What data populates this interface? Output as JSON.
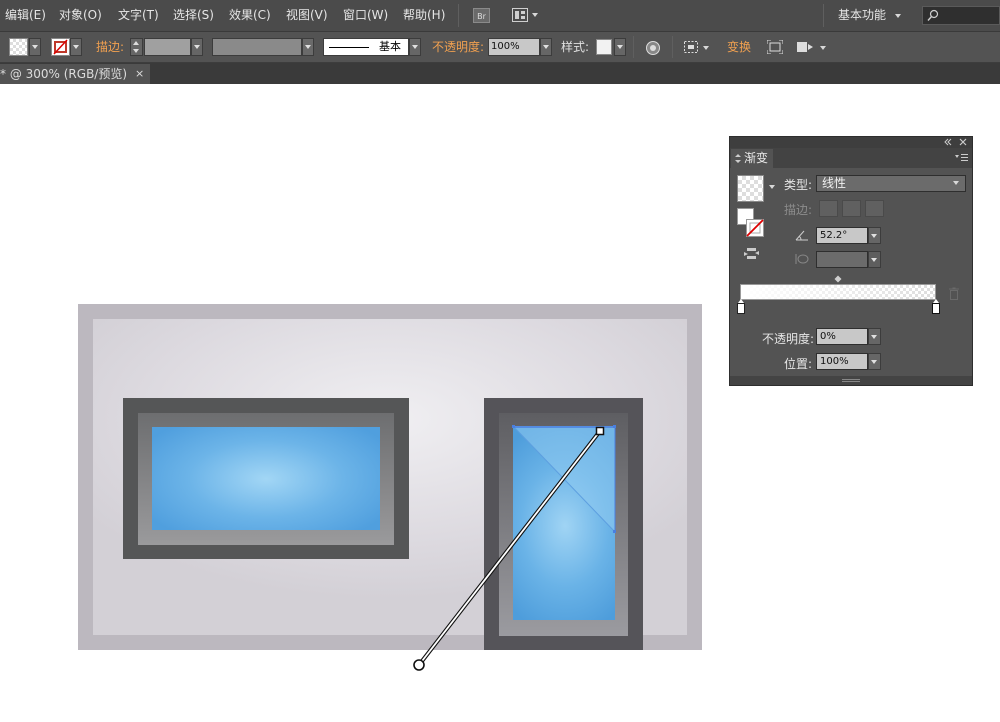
{
  "menu": {
    "items": [
      "编辑(E)",
      "对象(O)",
      "文字(T)",
      "选择(S)",
      "效果(C)",
      "视图(V)",
      "窗口(W)",
      "帮助(H)"
    ],
    "bridge_label": "Br",
    "workspace": "基本功能"
  },
  "control": {
    "stroke_label": "描边:",
    "stroke_style": "基本",
    "opacity_label": "不透明度:",
    "opacity_value": "100%",
    "style_label": "样式:",
    "transform_label": "变换"
  },
  "document": {
    "tab_title": "* @ 300% (RGB/预览)",
    "close": "×"
  },
  "gradient_panel": {
    "title": "渐变",
    "type_label": "类型:",
    "type_value": "线性",
    "stroke_label": "描边:",
    "angle_value": "52.2°",
    "opacity_label": "不透明度:",
    "opacity_value": "0%",
    "position_label": "位置:",
    "position_value": "100%"
  },
  "colors": {
    "ui_dark": "#4b4b4b",
    "accent_orange": "#f0a050",
    "glass_blue": "#6cb4e8"
  }
}
